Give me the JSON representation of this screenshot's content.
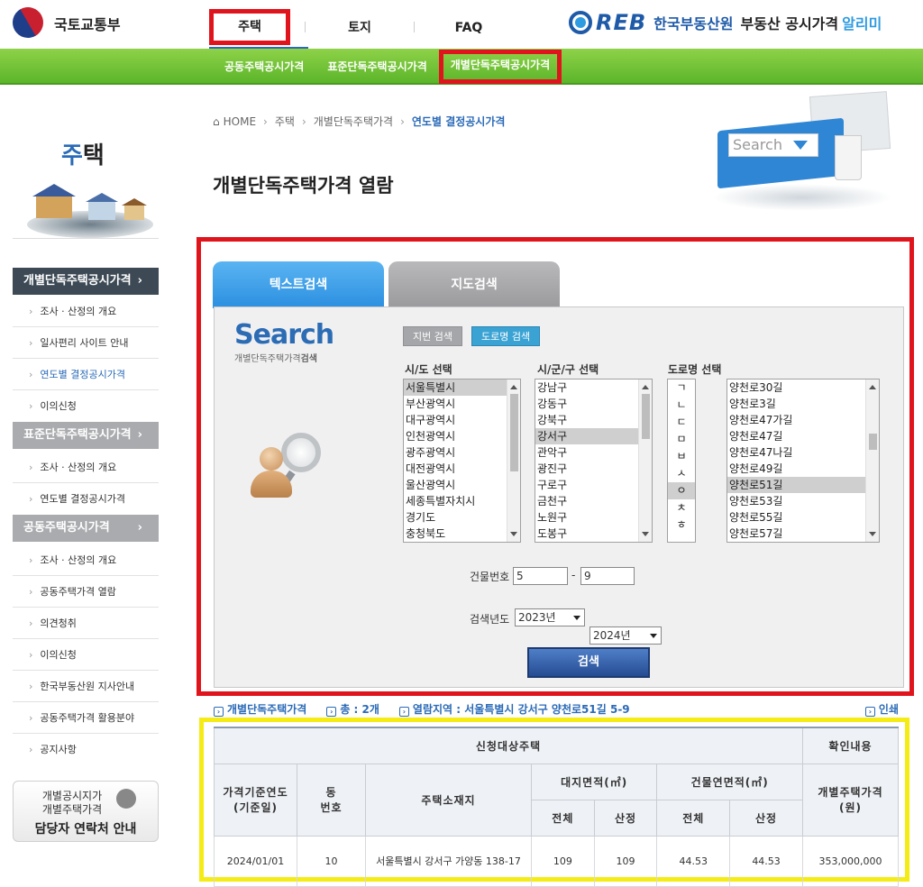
{
  "header": {
    "ministry": "국토교통부",
    "nav": [
      "주택",
      "토지",
      "FAQ"
    ],
    "reb_logo": "REB",
    "reb_name": "한국부동산원",
    "service_title_1": "부동산 공시가격",
    "service_title_2": "알리미"
  },
  "subnav": [
    "공동주택공시가격",
    "표준단독주택공시가격",
    "개별단독주택공시가격"
  ],
  "sidebar": {
    "title_first": "주",
    "title_rest": "택",
    "groups": [
      {
        "label": "개별단독주택공시가격",
        "arrow": "›",
        "items": [
          "조사 · 산정의 개요",
          "일사편리 사이트 안내",
          "연도별 결정공시가격",
          "이의신청"
        ]
      },
      {
        "label": "표준단독주택공시가격",
        "arrow": "›",
        "items": [
          "조사 · 산정의 개요",
          "연도별 결정공시가격"
        ]
      },
      {
        "label": "공동주택공시가격",
        "arrow": "›",
        "items": [
          "조사 · 산정의 개요",
          "공동주택가격 열람",
          "의견청취",
          "이의신청",
          "한국부동산원 지사안내",
          "공동주택가격 활용분야",
          "공지사항"
        ]
      }
    ],
    "bullet": "›",
    "contact_line1": "개별공시지가",
    "contact_line2": "개별주택가격",
    "contact_line3": "담당자 연락처 안내"
  },
  "breadcrumb": {
    "home": "HOME",
    "items": [
      "주택",
      "개별단독주택가격"
    ],
    "current": "연도별 결정공시가격",
    "sep": "›"
  },
  "page_title": "개별단독주택가격 열람",
  "deco_search_text": "Search",
  "search": {
    "tabs": [
      "텍스트검색",
      "지도검색"
    ],
    "logo": "Search",
    "logo_sub_a": "개별단독주택가격",
    "logo_sub_b": "검색",
    "mode_buttons": [
      "지번 검색",
      "도로명 검색"
    ],
    "sido_label": "시/도 선택",
    "sido_options": [
      "서울특별시",
      "부산광역시",
      "대구광역시",
      "인천광역시",
      "광주광역시",
      "대전광역시",
      "울산광역시",
      "세종특별자치시",
      "경기도",
      "충청북도"
    ],
    "sido_selected": 0,
    "sigungu_label": "시/군/구 선택",
    "sigungu_options": [
      "강남구",
      "강동구",
      "강북구",
      "강서구",
      "관악구",
      "광진구",
      "구로구",
      "금천구",
      "노원구",
      "도봉구"
    ],
    "sigungu_selected": 3,
    "road_label": "도로명 선택",
    "initials": [
      "ㄱ",
      "ㄴ",
      "ㄷ",
      "ㅁ",
      "ㅂ",
      "ㅅ",
      "ㅇ",
      "ㅊ",
      "ㅎ"
    ],
    "initial_selected": 6,
    "road_options": [
      "양천로30길",
      "양천로3길",
      "양천로47가길",
      "양천로47길",
      "양천로47나길",
      "양천로49길",
      "양천로51길",
      "양천로53길",
      "양천로55길",
      "양천로57길"
    ],
    "road_selected": 6,
    "building_label": "건물번호",
    "building_main": "5",
    "building_dash": "-",
    "building_sub": "9",
    "year_label": "검색년도",
    "year_from": "2023년",
    "year_to": "2024년",
    "submit": "검색"
  },
  "info": {
    "title": "개별단독주택가격",
    "total_label": "총 : ",
    "total_value": "2개",
    "area_label": "열람지역 : ",
    "area_value": "서울특별시 강서구 양천로51길 5-9",
    "print": "인쇄"
  },
  "table": {
    "group_target": "신청대상주택",
    "group_confirm": "확인내용",
    "col_year": "가격기준연도\n(기준일)",
    "col_dong": "동\n번호",
    "col_addr": "주택소재지",
    "col_land": "대지면적(㎡)",
    "col_bldg": "건물연면적(㎡)",
    "col_price": "개별주택가격\n(원)",
    "sub_total": "전체",
    "sub_calc": "산정",
    "rows": [
      {
        "year": "2024/01/01",
        "dong": "10",
        "addr": "서울특별시 강서구 가양동 138-17",
        "land_total": "109",
        "land_calc": "109",
        "bldg_total": "44.53",
        "bldg_calc": "44.53",
        "price": "353,000,000"
      }
    ]
  },
  "colors": {
    "green": "#5cb52a",
    "blue": "#2a6ab7",
    "red_highlight": "#e0141d",
    "yellow_highlight": "#f5ec15"
  }
}
